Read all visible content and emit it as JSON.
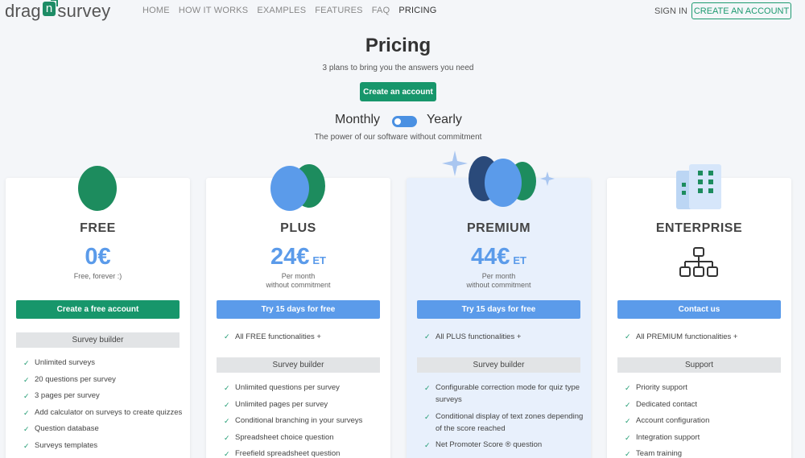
{
  "nav": {
    "logo_left": "drag",
    "logo_n": "n",
    "logo_right": "survey",
    "links": [
      "HOME",
      "HOW IT WORKS",
      "EXAMPLES",
      "FEATURES",
      "FAQ",
      "PRICING"
    ],
    "active_link": "PRICING",
    "signin": "SIGN IN",
    "create_account": "CREATE AN ACCOUNT"
  },
  "header": {
    "title": "Pricing",
    "subtitle": "3 plans to bring you the answers you need",
    "cta": "Create an account",
    "monthly": "Monthly",
    "yearly": "Yearly",
    "note": "The power of our software without commitment"
  },
  "colors": {
    "brand_green": "#17966b",
    "accent_blue": "#5b9bea",
    "premium_bg": "#e8f0fc",
    "egg_dark": "#1d8c5e",
    "egg_blue": "#5b9bea",
    "egg_navy": "#2a4a7a"
  },
  "plans": [
    {
      "name": "FREE",
      "price": "0€",
      "price_suffix": "",
      "note_line1": "Free, forever :)",
      "note_line2": "",
      "button": "Create a free account",
      "section": "Survey builder",
      "features": [
        "Unlimited surveys",
        "20 questions per survey",
        "3 pages per survey",
        "Add calculator on surveys to create quizzes",
        "Question database",
        "Surveys templates"
      ]
    },
    {
      "name": "PLUS",
      "price": "24€",
      "price_suffix": "ET",
      "note_line1": "Per month",
      "note_line2": "without commitment",
      "button": "Try 15 days for free",
      "top_feature": "All FREE functionalities +",
      "section": "Survey builder",
      "features": [
        "Unlimited questions per survey",
        "Unlimited pages per survey",
        "Conditional branching in your surveys",
        "Spreadsheet choice question",
        "Freefield spreadsheet question"
      ]
    },
    {
      "name": "PREMIUM",
      "price": "44€",
      "price_suffix": "ET",
      "note_line1": "Per month",
      "note_line2": "without commitment",
      "button": "Try 15 days for free",
      "top_feature": "All PLUS functionalities +",
      "section": "Survey builder",
      "features": [
        "Configurable correction mode for quiz type surveys",
        "Conditional display of text zones depending of the score reached",
        "Net Promoter Score ® question"
      ]
    },
    {
      "name": "ENTERPRISE",
      "button": "Contact us",
      "top_feature": "All PREMIUM functionalities +",
      "section": "Support",
      "features": [
        "Priority support",
        "Dedicated contact",
        "Account configuration",
        "Integration support",
        "Team training"
      ]
    }
  ]
}
